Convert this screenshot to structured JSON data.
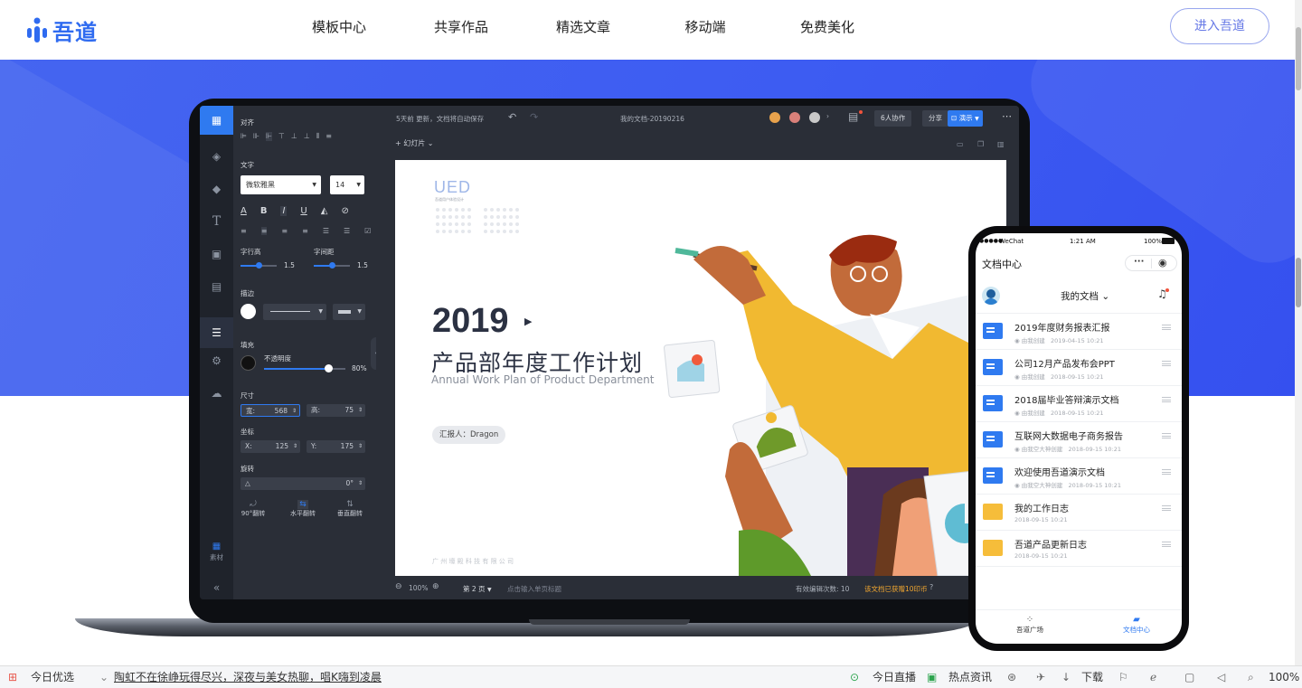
{
  "nav": {
    "logo_text": "吾道",
    "menu": [
      {
        "label": "模板中心"
      },
      {
        "label": "共享作品"
      },
      {
        "label": "精选文章"
      },
      {
        "label": "移动端"
      },
      {
        "label": "免费美化"
      }
    ],
    "enter_button": "进入吾道"
  },
  "editor": {
    "panel": {
      "align_label": "对齐",
      "text_label": "文字",
      "font_family": "微软雅黑",
      "font_size": "14",
      "line_height_label": "字行高",
      "line_height_value": "1.5",
      "letter_spacing_label": "字间距",
      "letter_spacing_value": "1.5",
      "stroke_label": "描边",
      "fill_label": "填充",
      "opacity_label": "不透明度",
      "opacity_value": "80%",
      "size_label": "尺寸",
      "width_label": "宽:",
      "width_value": "568",
      "height_label": "高:",
      "height_value": "75",
      "coord_label": "坐标",
      "x_label": "X:",
      "x_value": "125",
      "y_label": "Y:",
      "y_value": "175",
      "rotate_label": "旋转",
      "rotate_value": "0°",
      "flip_90": "90°翻转",
      "flip_h": "水平翻转",
      "flip_v": "垂直翻转",
      "material_label": "素材"
    },
    "topbar": {
      "autosave": "5天前 更新，文档将自动保存",
      "doc_name": "我的文档-20190216",
      "collab_button": "6人协作",
      "share_button": "分享",
      "present_button": "演示"
    },
    "slides_menu": "幻灯片",
    "slide": {
      "brand": "UED",
      "brand_sub": "吾道用户体验设计",
      "year": "2019",
      "title": "产品部年度工作计划",
      "subtitle": "Annual Work Plan of Product Department",
      "reporter": "汇报人：Dragon",
      "company": "广 州 壕 殿 科 技 有 限 公 司"
    },
    "bottombar": {
      "zoom": "100%",
      "page": "第 2 页",
      "page_title_placeholder": "点击输入单页标题",
      "edit_count": "有效编辑次数: 10",
      "reward": "该文档已获赠10印币"
    }
  },
  "phone": {
    "carrier": "WeChat",
    "time": "1:21 AM",
    "battery": "100%",
    "title": "文档中心",
    "dropdown": "我的文档",
    "items": [
      {
        "title": "2019年度财务报表汇报",
        "owner": "由我创建",
        "date": "2019-04-15  10:21",
        "type": "doc"
      },
      {
        "title": "公司12月产品发布会PPT",
        "owner": "由我创建",
        "date": "2018-09-15  10:21",
        "type": "doc"
      },
      {
        "title": "2018届毕业答辩演示文档",
        "owner": "由我创建",
        "date": "2018-09-15  10:21",
        "type": "doc"
      },
      {
        "title": "互联网大数据电子商务报告",
        "owner": "由我空大神创建",
        "date": "2018-09-15  10:21",
        "type": "doc"
      },
      {
        "title": "欢迎使用吾道演示文档",
        "owner": "由我空大神创建",
        "date": "2018-09-15  10:21",
        "type": "doc"
      },
      {
        "title": "我的工作日志",
        "owner": "",
        "date": "2018-09-15  10:21",
        "type": "folder"
      },
      {
        "title": "吾道产品更新日志",
        "owner": "",
        "date": "2018-09-15  10:21",
        "type": "folder"
      }
    ],
    "tab_square": "吾道广场",
    "tab_docs": "文档中心"
  },
  "taskbar": {
    "today_pick": "今日优选",
    "headline": "陶虹不在徐峥玩得尽兴，深夜与美女热聊，唱K嗨到凌晨",
    "live": "今日直播",
    "news": "热点资讯",
    "download": "下载",
    "zoom": "100%"
  }
}
